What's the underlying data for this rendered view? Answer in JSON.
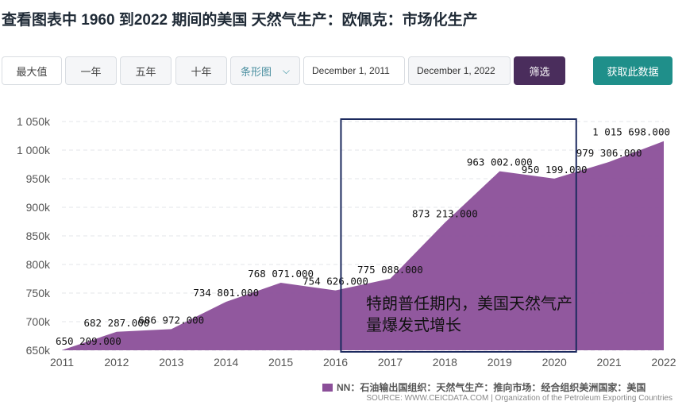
{
  "page": {
    "title": "查看图表中 1960 到2022 期间的美国 天然气生产：欧佩克：市场化生产"
  },
  "toolbar": {
    "range_buttons": [
      "最大值",
      "一年",
      "五年",
      "十年"
    ],
    "chart_type": "条形图",
    "date_from": "December 1, 2011",
    "date_to": "December 1, 2022",
    "filter_label": "筛选",
    "fetch_label": "获取此数据"
  },
  "legend": {
    "label": "NN：石油输出国组织：天然气生产：推向市场：经合组织美洲国家：美国"
  },
  "source": "SOURCE: WWW.CEICDATA.COM | Organization of the Petroleum Exporting Countries",
  "annotation": {
    "text": "特朗普任期内，美国天然气产量爆发式增长"
  },
  "chart_data": {
    "type": "area",
    "title": "",
    "xlabel": "",
    "ylabel": "",
    "x": [
      2011,
      2012,
      2013,
      2014,
      2015,
      2016,
      2017,
      2018,
      2019,
      2020,
      2021,
      2022
    ],
    "values": [
      650209,
      682287,
      686972,
      734801,
      768071,
      754626,
      775088,
      873213,
      963002,
      950199,
      979306,
      1015698
    ],
    "data_labels": [
      "650 209.000",
      "682 287.000",
      "686 972.000",
      "734 801.000",
      "768 071.000",
      "754 626.000",
      "775 088.000",
      "873 213.000",
      "963 002.000",
      "950 199.000",
      "979 306.000",
      "1 015 698.000"
    ],
    "x_ticks": [
      "2011",
      "2012",
      "2013",
      "2014",
      "2015",
      "2016",
      "2017",
      "2018",
      "2019",
      "2020",
      "2021",
      "2022"
    ],
    "y_ticks": [
      {
        "value": 650000,
        "label": "650k"
      },
      {
        "value": 700000,
        "label": "700k"
      },
      {
        "value": 750000,
        "label": "750k"
      },
      {
        "value": 800000,
        "label": "800k"
      },
      {
        "value": 850000,
        "label": "850k"
      },
      {
        "value": 900000,
        "label": "900k"
      },
      {
        "value": 950000,
        "label": "950k"
      },
      {
        "value": 1000000,
        "label": "1 000k"
      },
      {
        "value": 1050000,
        "label": "1 050k"
      }
    ],
    "ylim": [
      650000,
      1050000
    ],
    "xlim": [
      2011,
      2022
    ],
    "grid": true,
    "legend_position": "bottom-right",
    "color": "#8b4f99",
    "highlight": {
      "from": 2016.1,
      "to": 2020.4,
      "color": "#1c2a5e"
    }
  }
}
